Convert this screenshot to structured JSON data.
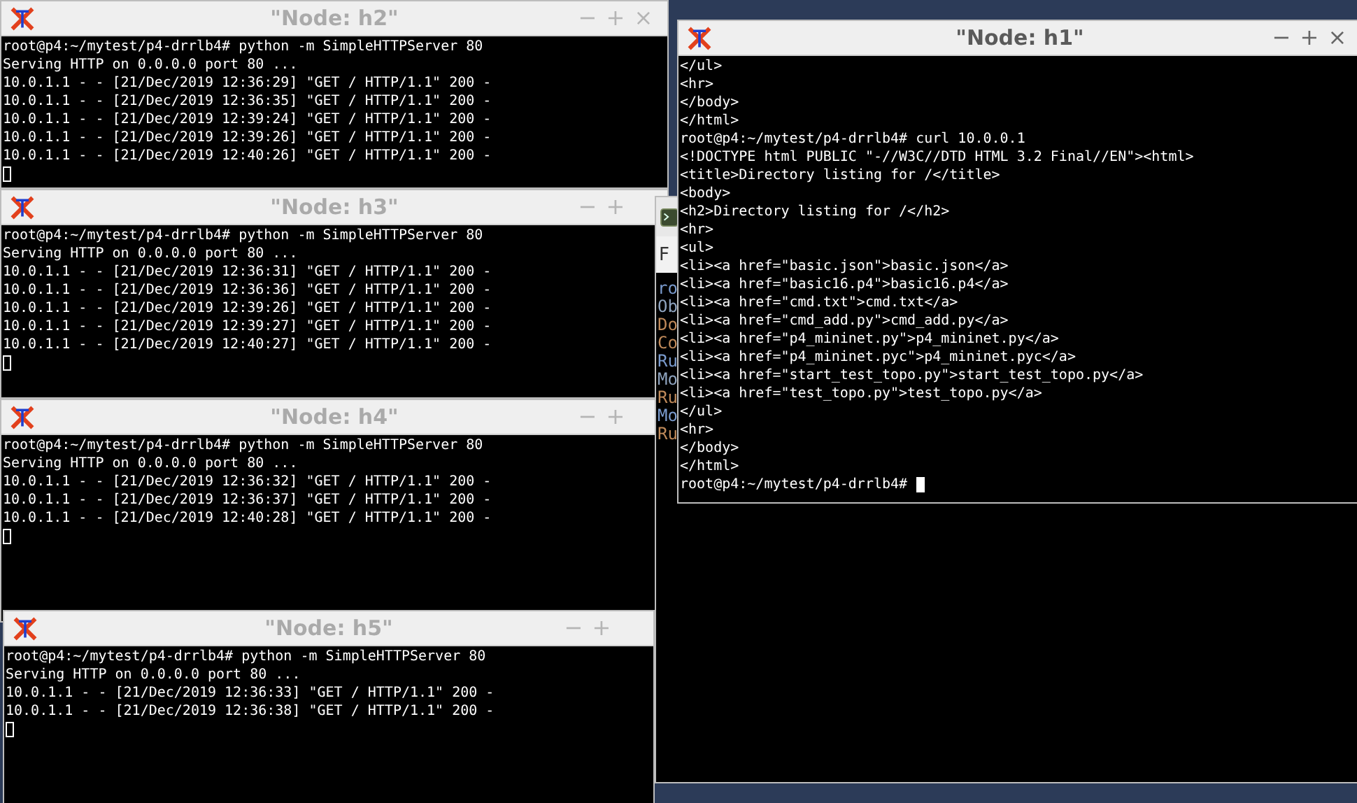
{
  "windows": [
    {
      "title": "\"Node: h2\"",
      "active": false,
      "controls": [
        "−",
        "+",
        "×"
      ],
      "lines": [
        "root@p4:~/mytest/p4-drrlb4# python -m SimpleHTTPServer 80",
        "Serving HTTP on 0.0.0.0 port 80 ...",
        "10.0.1.1 - - [21/Dec/2019 12:36:29] \"GET / HTTP/1.1\" 200 -",
        "10.0.1.1 - - [21/Dec/2019 12:36:35] \"GET / HTTP/1.1\" 200 -",
        "10.0.1.1 - - [21/Dec/2019 12:39:24] \"GET / HTTP/1.1\" 200 -",
        "10.0.1.1 - - [21/Dec/2019 12:39:26] \"GET / HTTP/1.1\" 200 -",
        "10.0.1.1 - - [21/Dec/2019 12:40:26] \"GET / HTTP/1.1\" 200 -"
      ]
    },
    {
      "title": "\"Node: h3\"",
      "active": false,
      "controls": [
        "−",
        "+"
      ],
      "lines": [
        "root@p4:~/mytest/p4-drrlb4# python -m SimpleHTTPServer 80",
        "Serving HTTP on 0.0.0.0 port 80 ...",
        "10.0.1.1 - - [21/Dec/2019 12:36:31] \"GET / HTTP/1.1\" 200 -",
        "10.0.1.1 - - [21/Dec/2019 12:36:36] \"GET / HTTP/1.1\" 200 -",
        "10.0.1.1 - - [21/Dec/2019 12:39:26] \"GET / HTTP/1.1\" 200 -",
        "10.0.1.1 - - [21/Dec/2019 12:39:27] \"GET / HTTP/1.1\" 200 -",
        "10.0.1.1 - - [21/Dec/2019 12:40:27] \"GET / HTTP/1.1\" 200 -"
      ]
    },
    {
      "title": "\"Node: h4\"",
      "active": false,
      "controls": [
        "−",
        "+"
      ],
      "lines": [
        "root@p4:~/mytest/p4-drrlb4# python -m SimpleHTTPServer 80",
        "Serving HTTP on 0.0.0.0 port 80 ...",
        "10.0.1.1 - - [21/Dec/2019 12:36:32] \"GET / HTTP/1.1\" 200 -",
        "10.0.1.1 - - [21/Dec/2019 12:36:37] \"GET / HTTP/1.1\" 200 -",
        "10.0.1.1 - - [21/Dec/2019 12:40:28] \"GET / HTTP/1.1\" 200 -"
      ]
    },
    {
      "title": "\"Node: h5\"",
      "active": false,
      "controls": [
        "−",
        "+"
      ],
      "lines": [
        "root@p4:~/mytest/p4-drrlb4# python -m SimpleHTTPServer 80",
        "Serving HTTP on 0.0.0.0 port 80 ...",
        "10.0.1.1 - - [21/Dec/2019 12:36:33] \"GET / HTTP/1.1\" 200 -",
        "10.0.1.1 - - [21/Dec/2019 12:36:38] \"GET / HTTP/1.1\" 200 -"
      ]
    },
    {
      "title": "\"Node: h1\"",
      "active": true,
      "controls": [
        "−",
        "+",
        "×"
      ],
      "lines": [
        "</ul>",
        "<hr>",
        "</body>",
        "</html>",
        "root@p4:~/mytest/p4-drrlb4# curl 10.0.0.1",
        "<!DOCTYPE html PUBLIC \"-//W3C//DTD HTML 3.2 Final//EN\"><html>",
        "<title>Directory listing for /</title>",
        "<body>",
        "<h2>Directory listing for /</h2>",
        "<hr>",
        "<ul>",
        "<li><a href=\"basic.json\">basic.json</a>",
        "<li><a href=\"basic16.p4\">basic16.p4</a>",
        "<li><a href=\"cmd.txt\">cmd.txt</a>",
        "<li><a href=\"cmd_add.py\">cmd_add.py</a>",
        "<li><a href=\"p4_mininet.py\">p4_mininet.py</a>",
        "<li><a href=\"p4_mininet.pyc\">p4_mininet.pyc</a>",
        "<li><a href=\"start_test_topo.py\">start_test_topo.py</a>",
        "<li><a href=\"test_topo.py\">test_topo.py</a>",
        "</ul>",
        "<hr>",
        "</body>",
        "</html>"
      ],
      "prompt": "root@p4:~/mytest/p4-drrlb4# "
    }
  ],
  "background_window": {
    "menu": "F",
    "lines": [
      {
        "text": "ro",
        "color": "#7b9ccf"
      },
      {
        "text": "Ob",
        "color": "#8fa4bf"
      },
      {
        "text": "Do",
        "color": "#c08a5a"
      },
      {
        "text": "Co",
        "color": "#c08a5a"
      },
      {
        "text": "Ru",
        "color": "#7b9ccf"
      },
      {
        "text": "Mo",
        "color": "#8fa4bf"
      },
      {
        "text": "Ru",
        "color": "#c08a5a"
      },
      {
        "text": "Mo",
        "color": "#7b9ccf"
      },
      {
        "text": "Ru",
        "color": "#c08a5a"
      }
    ]
  }
}
